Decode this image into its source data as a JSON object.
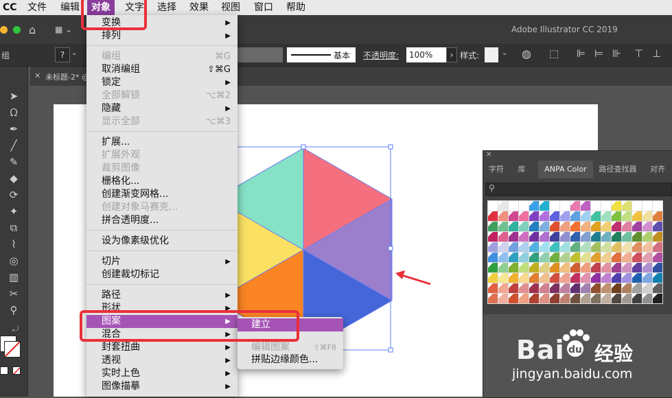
{
  "menubar": {
    "app": "CC",
    "items": [
      "文件",
      "编辑",
      "对象",
      "文字",
      "选择",
      "效果",
      "视图",
      "窗口",
      "帮助"
    ],
    "active": "对象"
  },
  "titlebar": {
    "app_title": "Adobe Illustrator CC 2019"
  },
  "controlbar": {
    "left_label": "组",
    "stroke_style": "基本",
    "opacity_label": "不透明度:",
    "opacity_value": "100%",
    "style_label": "样式:"
  },
  "document": {
    "tab_title": "未标题-2* @"
  },
  "object_menu": {
    "items": [
      {
        "label": "变换",
        "submenu": true
      },
      {
        "label": "排列",
        "submenu": true
      },
      {
        "sep": true
      },
      {
        "label": "编组",
        "shortcut": "⌘G",
        "disabled": true
      },
      {
        "label": "取消编组",
        "shortcut": "⇧⌘G"
      },
      {
        "label": "锁定",
        "submenu": true
      },
      {
        "label": "全部解锁",
        "shortcut": "⌥⌘2",
        "disabled": true
      },
      {
        "label": "隐藏",
        "submenu": true
      },
      {
        "label": "显示全部",
        "shortcut": "⌥⌘3",
        "disabled": true
      },
      {
        "sep": true
      },
      {
        "label": "扩展..."
      },
      {
        "label": "扩展外观",
        "disabled": true
      },
      {
        "label": "裁剪图像",
        "disabled": true
      },
      {
        "label": "栅格化..."
      },
      {
        "label": "创建渐变网格..."
      },
      {
        "label": "创建对象马赛克...",
        "disabled": true
      },
      {
        "label": "拼合透明度..."
      },
      {
        "sep": true
      },
      {
        "label": "设为像素级优化"
      },
      {
        "sep": true
      },
      {
        "label": "切片",
        "submenu": true
      },
      {
        "label": "创建裁切标记"
      },
      {
        "sep": true
      },
      {
        "label": "路径",
        "submenu": true
      },
      {
        "label": "形状",
        "submenu": true
      },
      {
        "label": "图案",
        "submenu": true,
        "highlight": true
      },
      {
        "label": "混合",
        "submenu": true
      },
      {
        "label": "封套扭曲",
        "submenu": true
      },
      {
        "label": "透视",
        "submenu": true
      },
      {
        "label": "实时上色",
        "submenu": true
      },
      {
        "label": "图像描摹",
        "submenu": true
      }
    ]
  },
  "pattern_submenu": {
    "items": [
      {
        "label": "建立",
        "highlight": true
      },
      {
        "label": "编辑图案",
        "shortcut": "⇧⌘F8",
        "disabled": true
      },
      {
        "label": "拼贴边缘颜色..."
      }
    ]
  },
  "panel": {
    "tabs": [
      "字符",
      "库",
      "ANPA Color",
      "路径查找器",
      "对齐"
    ],
    "active_tab": "ANPA Color",
    "swatch_colors": [
      "#ffffff",
      "#e8e8e8",
      "#ffffff",
      "#ffffff",
      "#3aa0e8",
      "#20b0d0",
      "#ffffff",
      "#ffffff",
      "#e87ab0",
      "#c060c0",
      "#ffffff",
      "#ffffff",
      "#f0e040",
      "#e0e070",
      "#ffffff",
      "#ffffff",
      "#ffffff",
      "#e03040",
      "#f09080",
      "#d04890",
      "#f070a0",
      "#8040c0",
      "#b070e0",
      "#6060e0",
      "#a0a0f0",
      "#60a0e0",
      "#a0d0f0",
      "#40c0a0",
      "#a0e0c0",
      "#80c040",
      "#c0e080",
      "#f0c040",
      "#f0e0a0",
      "#e08040",
      "#40a060",
      "#70c090",
      "#30b0a0",
      "#80d0c0",
      "#2080c0",
      "#80b0e0",
      "#e05030",
      "#f0a080",
      "#f07030",
      "#f0b080",
      "#e0a020",
      "#f0d070",
      "#c03070",
      "#e080a0",
      "#a040a0",
      "#d090d0",
      "#6050b0",
      "#c02060",
      "#e06090",
      "#a03090",
      "#d070c0",
      "#7030a0",
      "#b070d0",
      "#4040a0",
      "#9090d0",
      "#3060b0",
      "#80a0d0",
      "#208090",
      "#70b0c0",
      "#208060",
      "#70c0a0",
      "#609030",
      "#b0d070",
      "#c09020",
      "#a0a0e0",
      "#d0d0f0",
      "#70a0e0",
      "#b0d0f0",
      "#50b0e0",
      "#a0e0f0",
      "#40c0c0",
      "#a0e0e0",
      "#60b080",
      "#b0e0c0",
      "#a0c060",
      "#d0e0a0",
      "#e0c060",
      "#f0e0b0",
      "#e09060",
      "#f0c0a0",
      "#d07080",
      "#4090e0",
      "#90c0f0",
      "#30a0c0",
      "#90d0e0",
      "#30a080",
      "#90d0b0",
      "#70b040",
      "#b0d090",
      "#c0c030",
      "#e0e090",
      "#e0a030",
      "#f0d090",
      "#e07040",
      "#f0b090",
      "#d05060",
      "#e0a0b0",
      "#b050a0",
      "#30a040",
      "#90d090",
      "#80b030",
      "#c0e080",
      "#c0b020",
      "#e0d080",
      "#e09020",
      "#f0c080",
      "#d06030",
      "#f0a080",
      "#c04050",
      "#e090a0",
      "#a04090",
      "#d090c0",
      "#6040a0",
      "#b090d0",
      "#3050a0",
      "#f0d040",
      "#f8e890",
      "#f0b030",
      "#f8d890",
      "#e08030",
      "#f0c090",
      "#d05040",
      "#f0a090",
      "#c03060",
      "#e090b0",
      "#9030a0",
      "#c080d0",
      "#5040b0",
      "#a090e0",
      "#2060b0",
      "#80a8e0",
      "#1080b0",
      "#e06040",
      "#f0a890",
      "#c04040",
      "#e09090",
      "#a03050",
      "#d08090",
      "#803060",
      "#c080a0",
      "#603070",
      "#a080b0",
      "#905030",
      "#c09070",
      "#704020",
      "#b08060",
      "#a0a0a0",
      "#d0d0d0",
      "#606060",
      "#e07050",
      "#f0b0a0",
      "#d05030",
      "#f0a080",
      "#b04030",
      "#e09080",
      "#904030",
      "#c08070",
      "#705040",
      "#b0a090",
      "#807060",
      "#c0b0a0",
      "#504840",
      "#a09890",
      "#404040",
      "#909090",
      "#202020"
    ]
  },
  "watermark": {
    "brand": "Bai",
    "brand2": "经验",
    "url": "jingyan.baidu.com"
  }
}
